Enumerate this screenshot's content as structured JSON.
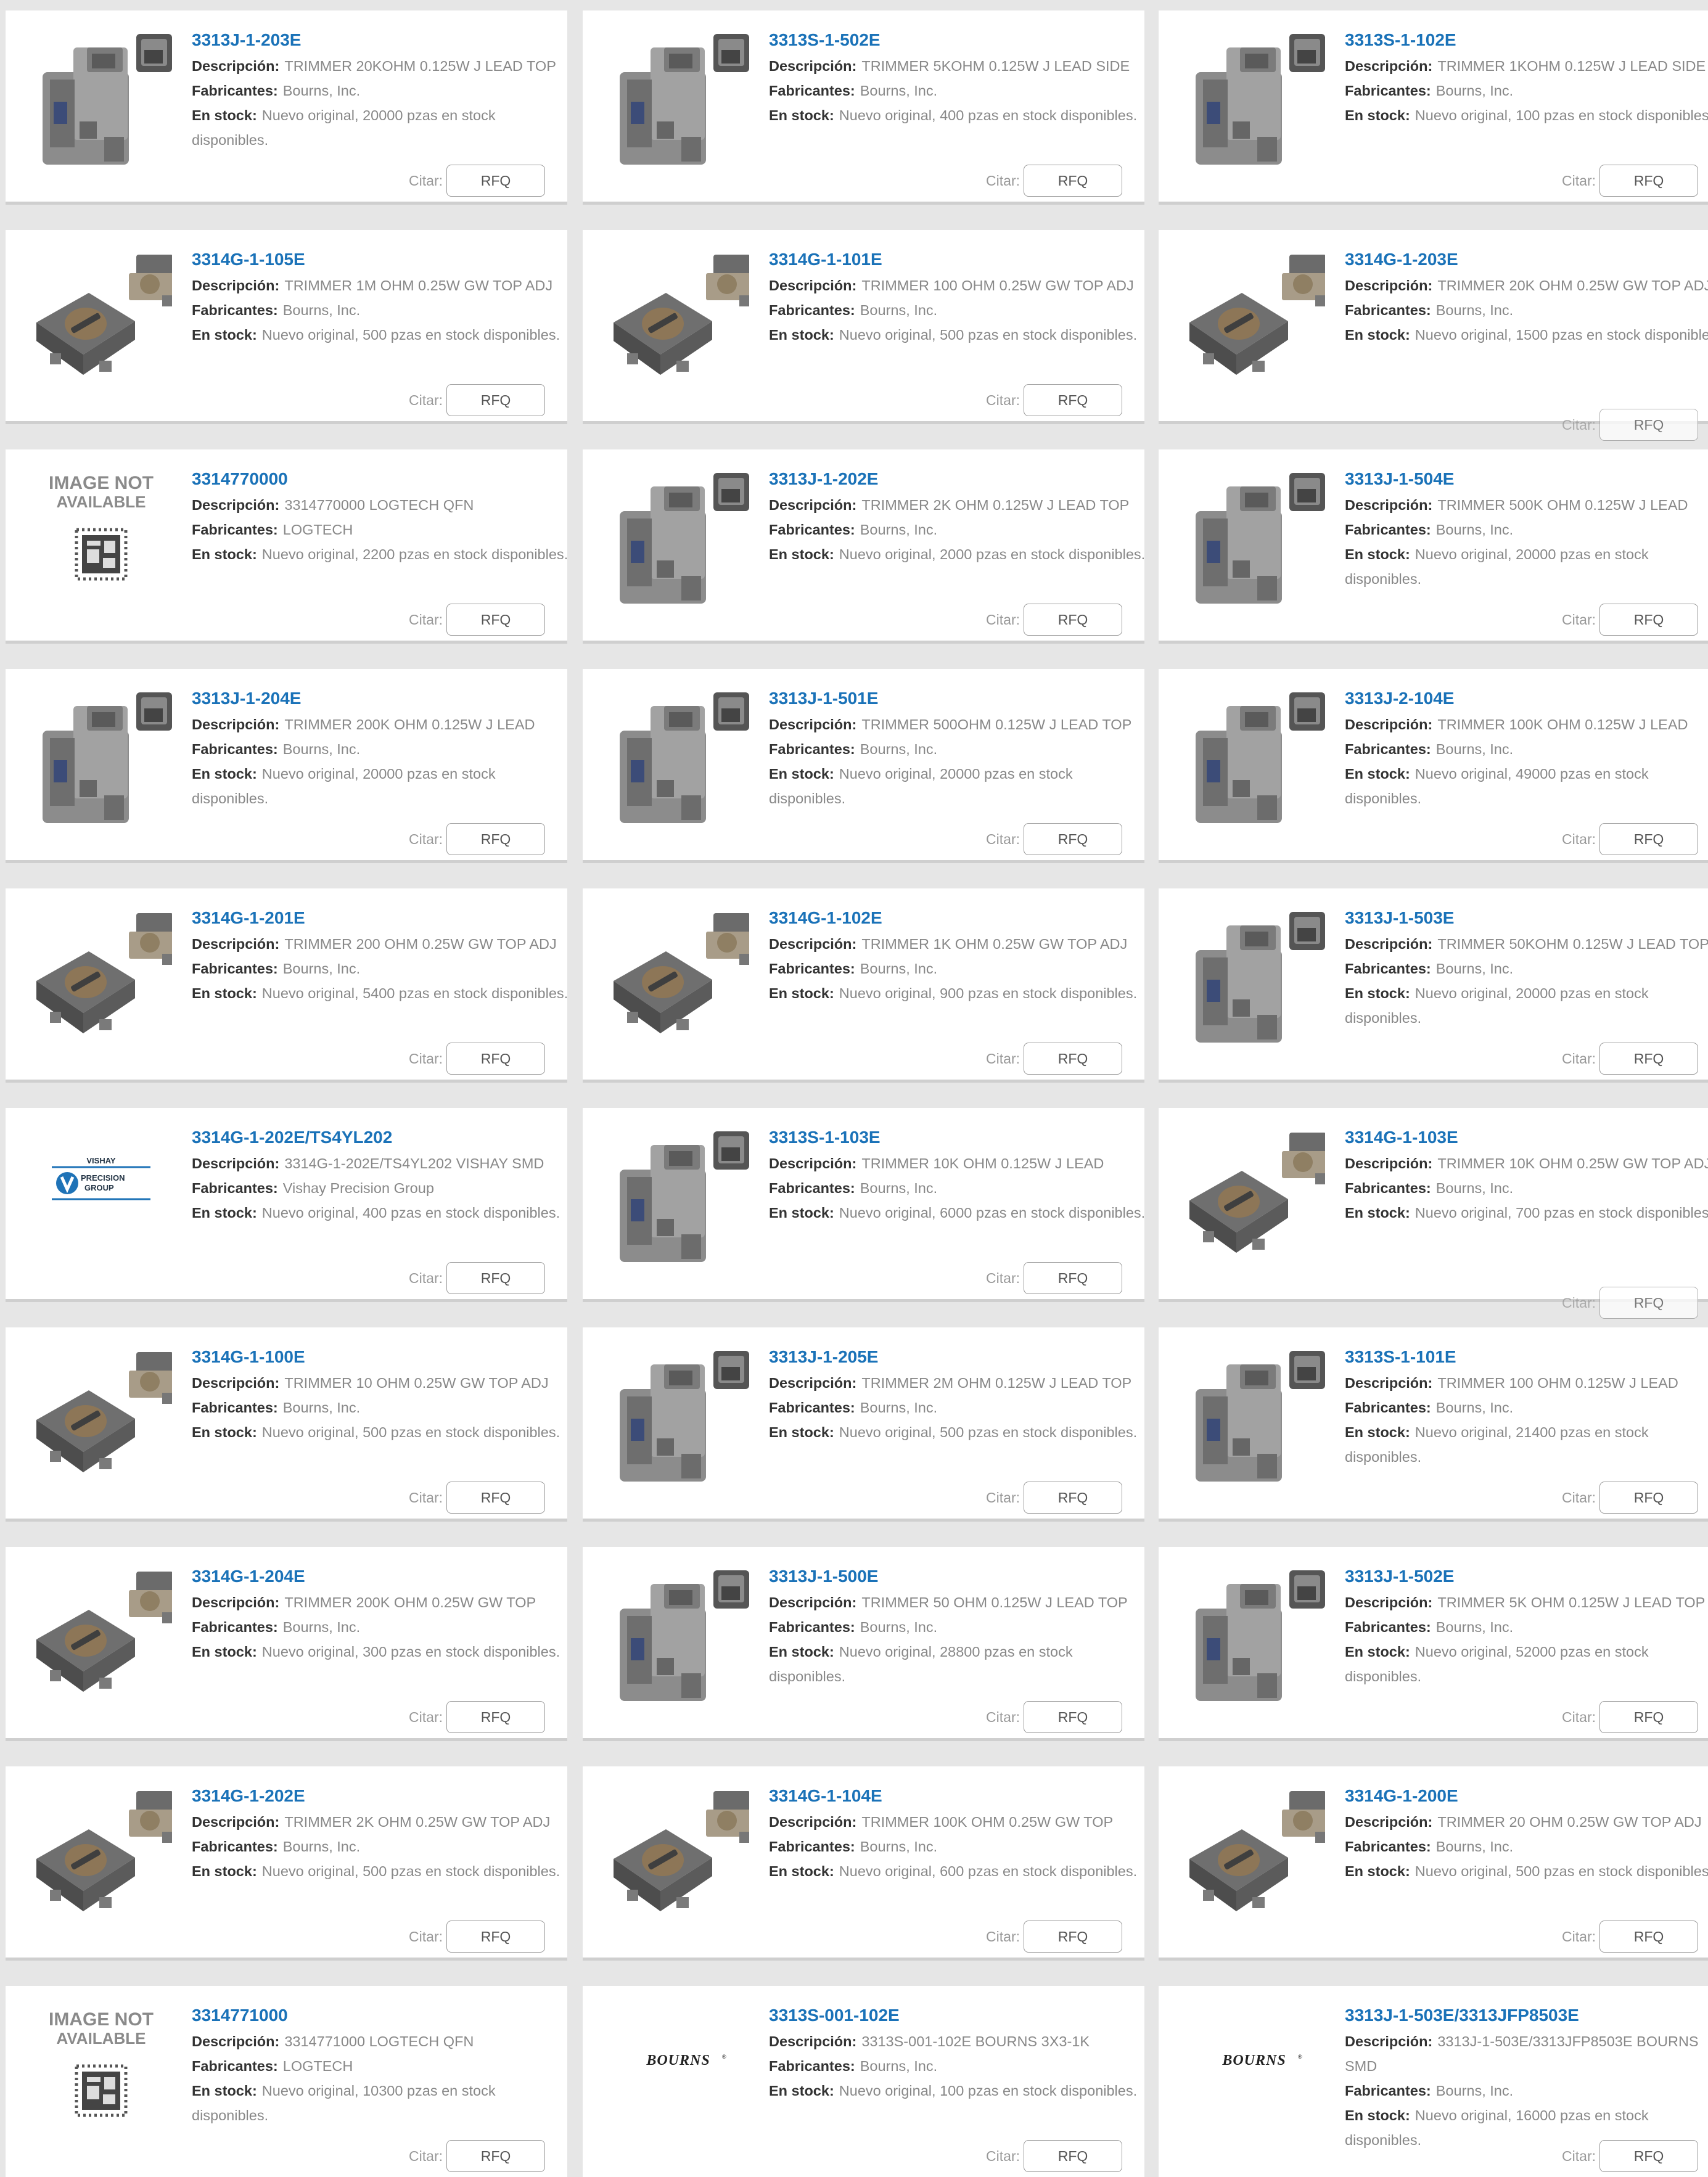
{
  "labels": {
    "descripcion": "Descripción:",
    "fabricantes": "Fabricantes:",
    "en_stock": "En stock:",
    "citar": "Citar:",
    "rfq": "RFQ",
    "image_not_available_1": "IMAGE NOT",
    "image_not_available_2": "AVAILABLE",
    "vishay_1": "VISHAY",
    "vishay_2": "PRECISION",
    "vishay_3": "GROUP",
    "bourns": "BOURNS"
  },
  "colors": {
    "part_link": "#1a72b8",
    "label_text": "#333333",
    "value_text": "#888888",
    "page_bg": "#e6e6e6"
  },
  "products": [
    {
      "part": "3313J-1-203E",
      "desc": "TRIMMER 20KOHM 0.125W J LEAD TOP",
      "mfr": "Bourns, Inc.",
      "stock": "Nuevo original, 20000 pzas en stock disponibles.",
      "image": "3313-icon"
    },
    {
      "part": "3313S-1-502E",
      "desc": "TRIMMER 5KOHM 0.125W J LEAD SIDE",
      "mfr": "Bourns, Inc.",
      "stock": "Nuevo original, 400 pzas en stock disponibles.",
      "image": "3313-icon"
    },
    {
      "part": "3313S-1-102E",
      "desc": "TRIMMER 1KOHM 0.125W J LEAD SIDE",
      "mfr": "Bourns, Inc.",
      "stock": "Nuevo original, 100 pzas en stock disponibles.",
      "image": "3313-icon"
    },
    {
      "part": "3314G-1-105E",
      "desc": "TRIMMER 1M OHM 0.25W GW TOP ADJ",
      "mfr": "Bourns, Inc.",
      "stock": "Nuevo original, 500 pzas en stock disponibles.",
      "image": "3314-icon"
    },
    {
      "part": "3314G-1-101E",
      "desc": "TRIMMER 100 OHM 0.25W GW TOP ADJ",
      "mfr": "Bourns, Inc.",
      "stock": "Nuevo original, 500 pzas en stock disponibles.",
      "image": "3314-icon"
    },
    {
      "part": "3314G-1-203E",
      "desc": "TRIMMER 20K OHM 0.25W GW TOP ADJ",
      "mfr": "Bourns, Inc.",
      "stock": "Nuevo original, 1500 pzas en stock disponibles.",
      "image": "3314-icon"
    },
    {
      "part": "3314770000",
      "desc": "3314770000 LOGTECH QFN",
      "mfr": "LOGTECH",
      "stock": "Nuevo original, 2200 pzas en stock disponibles.",
      "image": "image-not-available-icon"
    },
    {
      "part": "3313J-1-202E",
      "desc": "TRIMMER 2K OHM 0.125W J LEAD TOP",
      "mfr": "Bourns, Inc.",
      "stock": "Nuevo original, 2000 pzas en stock disponibles.",
      "image": "3313-icon"
    },
    {
      "part": "3313J-1-504E",
      "desc": "TRIMMER 500K OHM 0.125W J LEAD",
      "mfr": "Bourns, Inc.",
      "stock": "Nuevo original, 20000 pzas en stock disponibles.",
      "image": "3313-icon"
    },
    {
      "part": "3313J-1-204E",
      "desc": "TRIMMER 200K OHM 0.125W J LEAD",
      "mfr": "Bourns, Inc.",
      "stock": "Nuevo original, 20000 pzas en stock disponibles.",
      "image": "3313-icon"
    },
    {
      "part": "3313J-1-501E",
      "desc": "TRIMMER 500OHM 0.125W J LEAD TOP",
      "mfr": "Bourns, Inc.",
      "stock": "Nuevo original, 20000 pzas en stock disponibles.",
      "image": "3313-icon"
    },
    {
      "part": "3313J-2-104E",
      "desc": "TRIMMER 100K OHM 0.125W J LEAD",
      "mfr": "Bourns, Inc.",
      "stock": "Nuevo original, 49000 pzas en stock disponibles.",
      "image": "3313-icon"
    },
    {
      "part": "3314G-1-201E",
      "desc": "TRIMMER 200 OHM 0.25W GW TOP ADJ",
      "mfr": "Bourns, Inc.",
      "stock": "Nuevo original, 5400 pzas en stock disponibles.",
      "image": "3314-icon"
    },
    {
      "part": "3314G-1-102E",
      "desc": "TRIMMER 1K OHM 0.25W GW TOP ADJ",
      "mfr": "Bourns, Inc.",
      "stock": "Nuevo original, 900 pzas en stock disponibles.",
      "image": "3314-icon"
    },
    {
      "part": "3313J-1-503E",
      "desc": "TRIMMER 50KOHM 0.125W J LEAD TOP",
      "mfr": "Bourns, Inc.",
      "stock": "Nuevo original, 20000 pzas en stock disponibles.",
      "image": "3313-icon"
    },
    {
      "part": "3314G-1-202E/TS4YL202",
      "desc": "3314G-1-202E/TS4YL202 VISHAY SMD",
      "mfr": "Vishay Precision Group",
      "stock": "Nuevo original, 400 pzas en stock disponibles.",
      "image": "vishay-logo-icon"
    },
    {
      "part": "3313S-1-103E",
      "desc": "TRIMMER 10K OHM 0.125W J LEAD",
      "mfr": "Bourns, Inc.",
      "stock": "Nuevo original, 6000 pzas en stock disponibles.",
      "image": "3313-icon"
    },
    {
      "part": "3314G-1-103E",
      "desc": "TRIMMER 10K OHM 0.25W GW TOP ADJ",
      "mfr": "Bourns, Inc.",
      "stock": "Nuevo original, 700 pzas en stock disponibles.",
      "image": "3314-icon"
    },
    {
      "part": "3314G-1-100E",
      "desc": "TRIMMER 10 OHM 0.25W GW TOP ADJ",
      "mfr": "Bourns, Inc.",
      "stock": "Nuevo original, 500 pzas en stock disponibles.",
      "image": "3314-icon"
    },
    {
      "part": "3313J-1-205E",
      "desc": "TRIMMER 2M OHM 0.125W J LEAD TOP",
      "mfr": "Bourns, Inc.",
      "stock": "Nuevo original, 500 pzas en stock disponibles.",
      "image": "3313-icon"
    },
    {
      "part": "3313S-1-101E",
      "desc": "TRIMMER 100 OHM 0.125W J LEAD",
      "mfr": "Bourns, Inc.",
      "stock": "Nuevo original, 21400 pzas en stock disponibles.",
      "image": "3313-icon"
    },
    {
      "part": "3314G-1-204E",
      "desc": "TRIMMER 200K OHM 0.25W GW TOP",
      "mfr": "Bourns, Inc.",
      "stock": "Nuevo original, 300 pzas en stock disponibles.",
      "image": "3314-icon"
    },
    {
      "part": "3313J-1-500E",
      "desc": "TRIMMER 50 OHM 0.125W J LEAD TOP",
      "mfr": "Bourns, Inc.",
      "stock": "Nuevo original, 28800 pzas en stock disponibles.",
      "image": "3313-icon"
    },
    {
      "part": "3313J-1-502E",
      "desc": "TRIMMER 5K OHM 0.125W J LEAD TOP",
      "mfr": "Bourns, Inc.",
      "stock": "Nuevo original, 52000 pzas en stock disponibles.",
      "image": "3313-icon"
    },
    {
      "part": "3314G-1-202E",
      "desc": "TRIMMER 2K OHM 0.25W GW TOP ADJ",
      "mfr": "Bourns, Inc.",
      "stock": "Nuevo original, 500 pzas en stock disponibles.",
      "image": "3314-icon"
    },
    {
      "part": "3314G-1-104E",
      "desc": "TRIMMER 100K OHM 0.25W GW TOP",
      "mfr": "Bourns, Inc.",
      "stock": "Nuevo original, 600 pzas en stock disponibles.",
      "image": "3314-icon"
    },
    {
      "part": "3314G-1-200E",
      "desc": "TRIMMER 20 OHM 0.25W GW TOP ADJ",
      "mfr": "Bourns, Inc.",
      "stock": "Nuevo original, 500 pzas en stock disponibles.",
      "image": "3314-icon"
    },
    {
      "part": "3314771000",
      "desc": "3314771000 LOGTECH QFN",
      "mfr": "LOGTECH",
      "stock": "Nuevo original, 10300 pzas en stock disponibles.",
      "image": "image-not-available-icon"
    },
    {
      "part": "3313S-001-102E",
      "desc": "3313S-001-102E BOURNS 3X3-1K",
      "mfr": "Bourns, Inc.",
      "stock": "Nuevo original, 100 pzas en stock disponibles.",
      "image": "bourns-logo-icon"
    },
    {
      "part": "3313J-1-503E/3313JFP8503E",
      "desc": "3313J-1-503E/3313JFP8503E BOURNS SMD",
      "mfr": "Bourns, Inc.",
      "stock": "Nuevo original, 16000 pzas en stock disponibles.",
      "image": "bourns-logo-icon"
    }
  ]
}
